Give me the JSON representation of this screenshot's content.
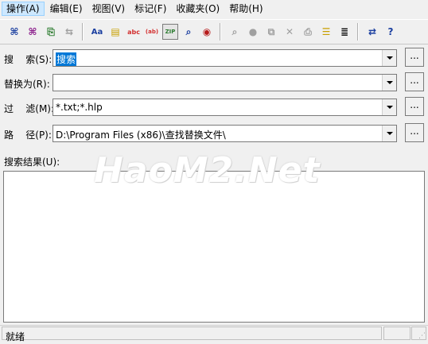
{
  "menu": {
    "items": [
      "操作(A)",
      "编辑(E)",
      "视图(V)",
      "标记(F)",
      "收藏夹(O)",
      "帮助(H)"
    ]
  },
  "toolbar": {
    "buttons": [
      {
        "icon": "binoculars-icon",
        "glyph": "👀",
        "enabled": true
      },
      {
        "icon": "find-next-icon",
        "glyph": "👀",
        "enabled": true
      },
      {
        "icon": "document-export-icon",
        "glyph": "⎘",
        "enabled": true
      },
      {
        "icon": "network-icon",
        "glyph": "⇆",
        "enabled": false
      },
      {
        "icon": "match-case-icon",
        "glyph": "Aa",
        "enabled": true
      },
      {
        "icon": "whole-word-icon",
        "glyph": "▤",
        "enabled": true
      },
      {
        "icon": "regex-abc-icon",
        "glyph": "abc",
        "enabled": true
      },
      {
        "icon": "regex-ab-icon",
        "glyph": "(ab)",
        "enabled": true
      },
      {
        "icon": "zip-search-icon",
        "glyph": "ZIP",
        "enabled": true
      },
      {
        "icon": "subfolder-search-icon",
        "glyph": "⌕",
        "enabled": true
      },
      {
        "icon": "binary-search-icon",
        "glyph": "◉",
        "enabled": true
      },
      {
        "icon": "view-file-icon",
        "glyph": "⌕",
        "enabled": false
      },
      {
        "icon": "open-file-icon",
        "glyph": "●",
        "enabled": false
      },
      {
        "icon": "copy-icon",
        "glyph": "⧉",
        "enabled": false
      },
      {
        "icon": "delete-icon",
        "glyph": "✕",
        "enabled": false
      },
      {
        "icon": "print-icon",
        "glyph": "⎙",
        "enabled": false
      },
      {
        "icon": "scroll-icon",
        "glyph": "☰",
        "enabled": true
      },
      {
        "icon": "list-icon",
        "glyph": "≣",
        "enabled": true
      },
      {
        "icon": "replace-icon",
        "glyph": "⇄",
        "enabled": true
      },
      {
        "icon": "help-icon",
        "glyph": "?",
        "enabled": true
      }
    ]
  },
  "search": {
    "label": "搜    索(S):",
    "value": "搜索"
  },
  "replace": {
    "label": "替换为(R):",
    "value": ""
  },
  "filter": {
    "label": "过    滤(M):",
    "value": "*.txt;*.hlp"
  },
  "path": {
    "label": "路    径(P):",
    "value": "D:\\Program Files (x86)\\查找替换文件\\"
  },
  "browse_label": "...",
  "results": {
    "label": "搜索结果(U):"
  },
  "watermark": "HaoM2.Net",
  "status": {
    "text": "就绪"
  }
}
